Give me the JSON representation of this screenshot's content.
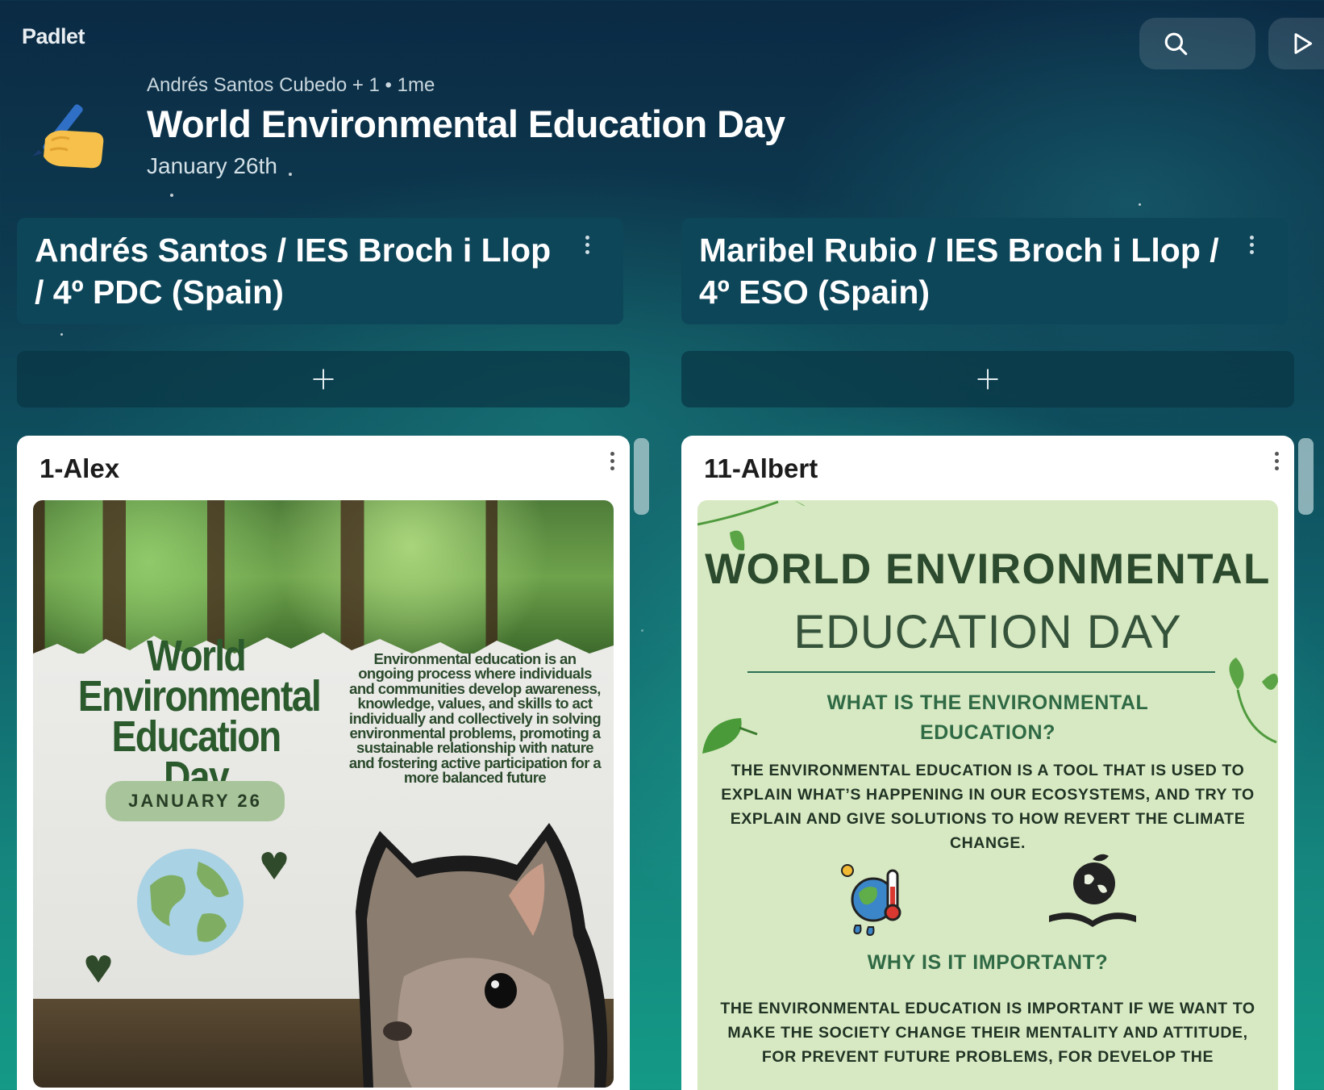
{
  "app": {
    "logo": "Padlet",
    "search_icon": "search-icon",
    "play_icon": "play-icon"
  },
  "board": {
    "meta": "Andrés Santos Cubedo + 1 • 1me",
    "title": "World Environmental Education Day",
    "subtitle": "January 26th",
    "emoji": "writing-hand-icon"
  },
  "sections": [
    {
      "title": "Andrés Santos / IES Broch i Llop / 4º PDC (Spain)",
      "title_line1": "Andrés Santos / IES Broch i Llop",
      "title_line2": "/ 4º PDC (Spain)",
      "add_icon": "plus-icon",
      "posts": [
        {
          "title": "1-Alex",
          "image": {
            "heading_line1": "World",
            "heading_line2": "Environmental",
            "heading_line3": "Education Day",
            "date": "JANUARY 26",
            "description": "Environmental education is an ongoing process where individuals and communities develop awareness, knowledge, values, and skills to act individually and collectively in solving environmental problems, promoting a sustainable relationship with nature and fostering active participation for a more balanced future"
          }
        }
      ]
    },
    {
      "title": "Maribel Rubio / IES Broch i Llop / 4º ESO (Spain)",
      "title_line1": "Maribel Rubio / IES Broch i Llop /",
      "title_line2": "4º ESO (Spain)",
      "add_icon": "plus-icon",
      "posts": [
        {
          "title": "11-Albert",
          "image": {
            "heading1": "WORLD ENVIRONMENTAL",
            "heading2": "EDUCATION DAY",
            "question1_line1": "WHAT IS THE ENVIRONMENTAL",
            "question1_line2": "EDUCATION?",
            "answer1": "THE ENVIRONMENTAL EDUCATION IS A TOOL THAT IS USED TO EXPLAIN WHAT’S HAPPENING IN OUR ECOSYSTEMS, AND TRY TO EXPLAIN AND GIVE SOLUTIONS TO HOW REVERT THE CLIMATE CHANGE.",
            "question2": "WHY IS IT IMPORTANT?",
            "answer2": "THE ENVIRONMENTAL EDUCATION IS IMPORTANT IF WE WANT TO MAKE THE SOCIETY CHANGE THEIR MENTALITY AND ATTITUDE, FOR PREVENT FUTURE PROBLEMS, FOR DEVELOP THE"
          }
        }
      ]
    }
  ],
  "colors": {
    "section_header": "#0d4559",
    "card": "#ffffff",
    "infographic_bg": "#d7e9c2",
    "infographic_text": "#2c4a2e"
  }
}
